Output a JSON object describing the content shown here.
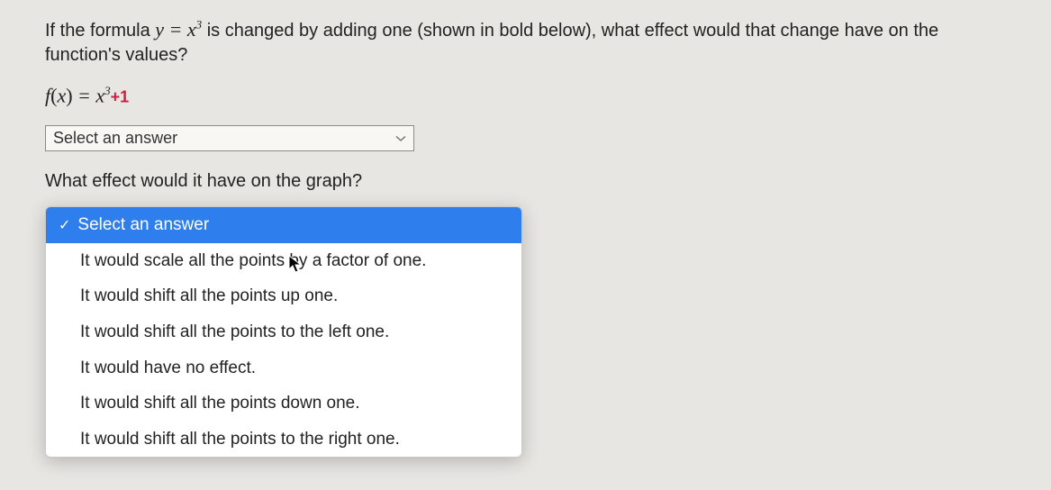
{
  "question1": {
    "text_before": "If the formula ",
    "formula_y": "y",
    "formula_eq": " = ",
    "formula_x": "x",
    "formula_exp": "3",
    "text_after": " is changed by adding one (shown in bold below), what effect would that change have on the function's values?"
  },
  "equation": {
    "f": "f",
    "paren_open": "(",
    "x": "x",
    "paren_close": ")",
    "eq": " = ",
    "base": "x",
    "exp": "3",
    "plus_one": "+1"
  },
  "select1": {
    "placeholder": "Select an answer"
  },
  "question2": {
    "text": "What effect would it have on the graph?"
  },
  "dropdown": {
    "selected_label": "Select an answer",
    "options": [
      "It would scale all the points by a factor of one.",
      "It would shift all the points up one.",
      "It would shift all the points to the left one.",
      "It would have no effect.",
      "It would shift all the points down one.",
      "It would shift all the points to the right one."
    ]
  }
}
